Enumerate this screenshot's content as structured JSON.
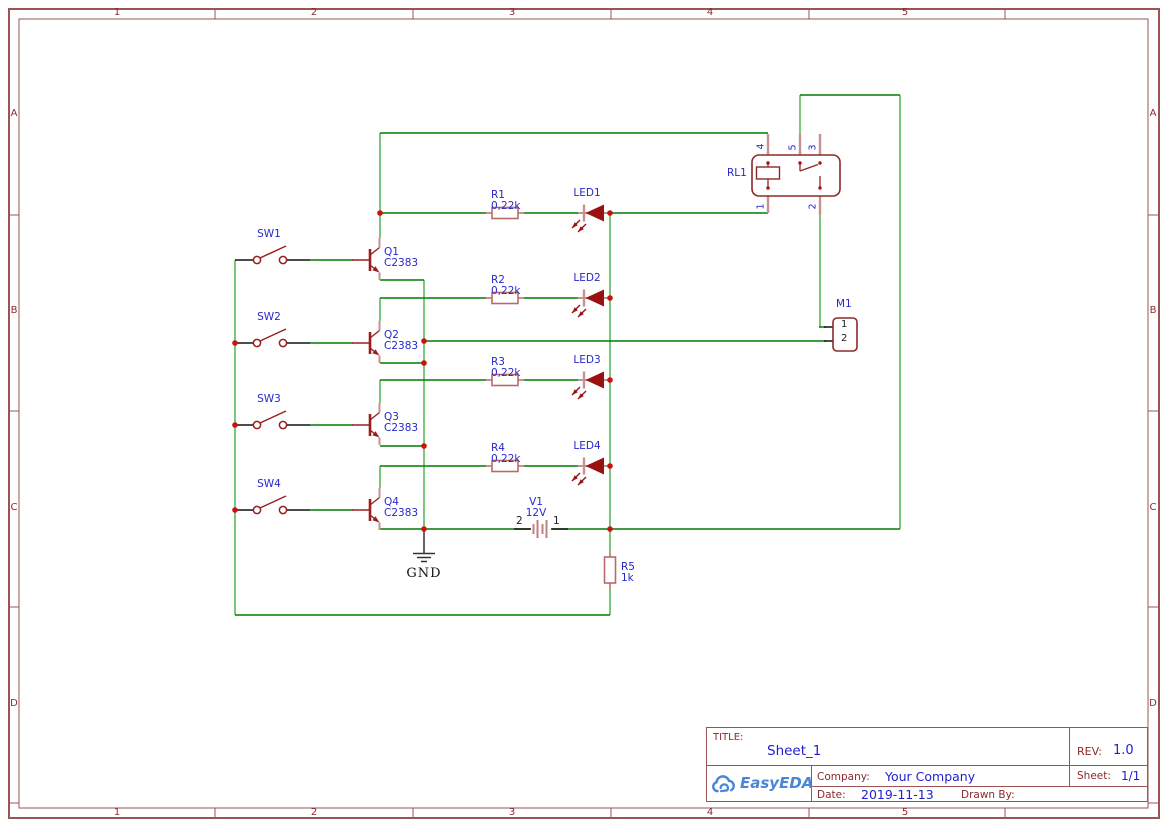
{
  "sheet": {
    "columns": [
      "1",
      "2",
      "3",
      "4",
      "5"
    ],
    "rows": [
      "A",
      "B",
      "C",
      "D"
    ]
  },
  "colors": {
    "wire": "#007c00",
    "wire_vertical": "#7cc67c",
    "component_stroke": "#991f1f",
    "pin_stroke": "#c89090",
    "junction_dot": "#cc1111",
    "label_blue": "#2727cc",
    "frame": "#9a5454",
    "logo_blue": "#4a86d8"
  },
  "components": {
    "switches": [
      {
        "ref": "SW1"
      },
      {
        "ref": "SW2"
      },
      {
        "ref": "SW3"
      },
      {
        "ref": "SW4"
      }
    ],
    "transistors": [
      {
        "ref": "Q1",
        "value": "C2383"
      },
      {
        "ref": "Q2",
        "value": "C2383"
      },
      {
        "ref": "Q3",
        "value": "C2383"
      },
      {
        "ref": "Q4",
        "value": "C2383"
      }
    ],
    "resistors": [
      {
        "ref": "R1",
        "value": "0,22k"
      },
      {
        "ref": "R2",
        "value": "0,22k"
      },
      {
        "ref": "R3",
        "value": "0,22k"
      },
      {
        "ref": "R4",
        "value": "0,22k"
      },
      {
        "ref": "R5",
        "value": "1k"
      }
    ],
    "leds": [
      {
        "ref": "LED1"
      },
      {
        "ref": "LED2"
      },
      {
        "ref": "LED3"
      },
      {
        "ref": "LED4"
      }
    ],
    "relay": {
      "ref": "RL1",
      "pins": [
        "4",
        "5",
        "3",
        "1",
        "2"
      ]
    },
    "connector": {
      "ref": "M1",
      "pins": [
        "1",
        "2"
      ]
    },
    "battery": {
      "ref": "V1",
      "value": "12V",
      "pin_left": "2",
      "pin_right": "1"
    },
    "ground": {
      "label": "GND"
    }
  },
  "title_block": {
    "title_label": "TITLE:",
    "title": "Sheet_1",
    "rev_label": "REV:",
    "rev": "1.0",
    "company_label": "Company:",
    "company": "Your Company",
    "sheet_label": "Sheet:",
    "sheet": "1/1",
    "date_label": "Date:",
    "date": "2019-11-13",
    "drawn_by_label": "Drawn By:",
    "logo_text": "EasyEDA"
  }
}
